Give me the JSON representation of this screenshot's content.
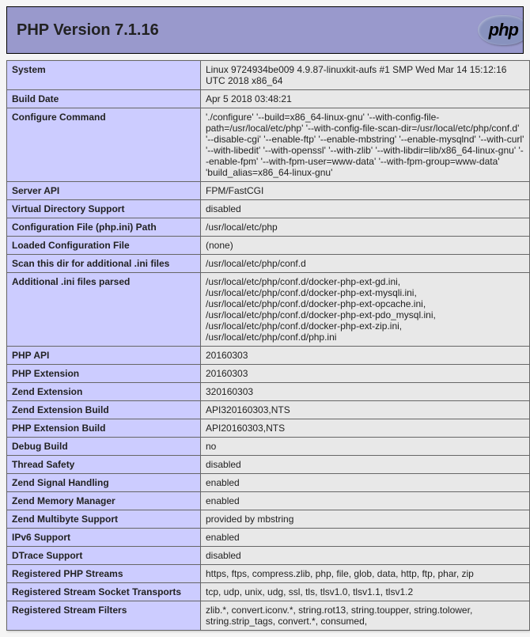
{
  "header": {
    "title": "PHP Version 7.1.16",
    "logo_text": "php"
  },
  "rows": [
    {
      "label": "System",
      "value": "Linux 9724934be009 4.9.87-linuxkit-aufs #1 SMP Wed Mar 14 15:12:16 UTC 2018 x86_64"
    },
    {
      "label": "Build Date",
      "value": "Apr 5 2018 03:48:21"
    },
    {
      "label": "Configure Command",
      "value": "'./configure' '--build=x86_64-linux-gnu' '--with-config-file-path=/usr/local/etc/php' '--with-config-file-scan-dir=/usr/local/etc/php/conf.d' '--disable-cgi' '--enable-ftp' '--enable-mbstring' '--enable-mysqlnd' '--with-curl' '--with-libedit' '--with-openssl' '--with-zlib' '--with-libdir=lib/x86_64-linux-gnu' '--enable-fpm' '--with-fpm-user=www-data' '--with-fpm-group=www-data' 'build_alias=x86_64-linux-gnu'"
    },
    {
      "label": "Server API",
      "value": "FPM/FastCGI"
    },
    {
      "label": "Virtual Directory Support",
      "value": "disabled"
    },
    {
      "label": "Configuration File (php.ini) Path",
      "value": "/usr/local/etc/php"
    },
    {
      "label": "Loaded Configuration File",
      "value": "(none)"
    },
    {
      "label": "Scan this dir for additional .ini files",
      "value": "/usr/local/etc/php/conf.d"
    },
    {
      "label": "Additional .ini files parsed",
      "value": "/usr/local/etc/php/conf.d/docker-php-ext-gd.ini, /usr/local/etc/php/conf.d/docker-php-ext-mysqli.ini, /usr/local/etc/php/conf.d/docker-php-ext-opcache.ini, /usr/local/etc/php/conf.d/docker-php-ext-pdo_mysql.ini, /usr/local/etc/php/conf.d/docker-php-ext-zip.ini, /usr/local/etc/php/conf.d/php.ini"
    },
    {
      "label": "PHP API",
      "value": "20160303"
    },
    {
      "label": "PHP Extension",
      "value": "20160303"
    },
    {
      "label": "Zend Extension",
      "value": "320160303"
    },
    {
      "label": "Zend Extension Build",
      "value": "API320160303,NTS"
    },
    {
      "label": "PHP Extension Build",
      "value": "API20160303,NTS"
    },
    {
      "label": "Debug Build",
      "value": "no"
    },
    {
      "label": "Thread Safety",
      "value": "disabled"
    },
    {
      "label": "Zend Signal Handling",
      "value": "enabled"
    },
    {
      "label": "Zend Memory Manager",
      "value": "enabled"
    },
    {
      "label": "Zend Multibyte Support",
      "value": "provided by mbstring"
    },
    {
      "label": "IPv6 Support",
      "value": "enabled"
    },
    {
      "label": "DTrace Support",
      "value": "disabled"
    },
    {
      "label": "Registered PHP Streams",
      "value": "https, ftps, compress.zlib, php, file, glob, data, http, ftp, phar, zip"
    },
    {
      "label": "Registered Stream Socket Transports",
      "value": "tcp, udp, unix, udg, ssl, tls, tlsv1.0, tlsv1.1, tlsv1.2"
    },
    {
      "label": "Registered Stream Filters",
      "value": "zlib.*, convert.iconv.*, string.rot13, string.toupper, string.tolower, string.strip_tags, convert.*, consumed,"
    }
  ]
}
